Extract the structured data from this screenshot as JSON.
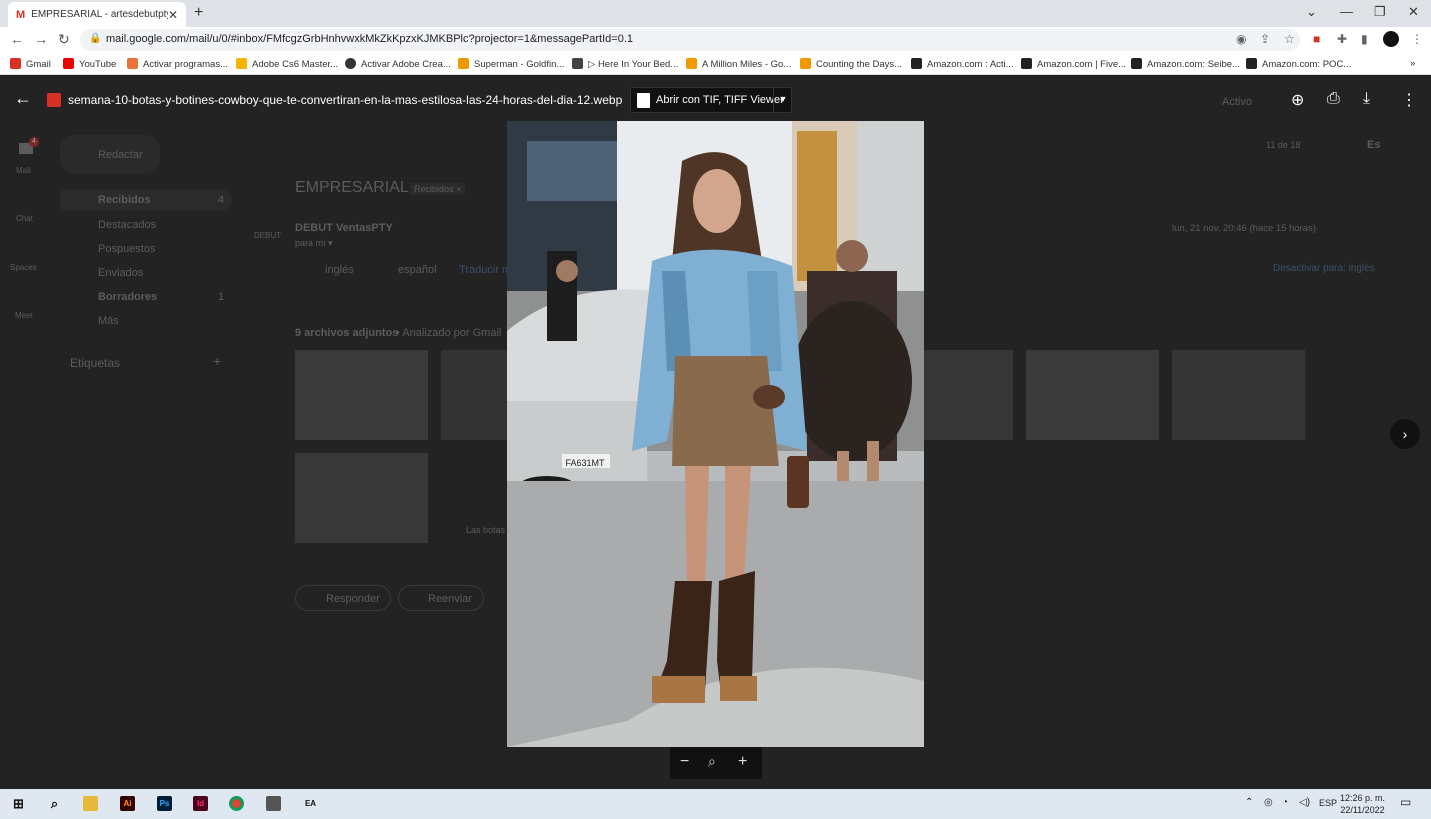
{
  "browser": {
    "tab_title": "EMPRESARIAL - artesdebutpty@",
    "url": "mail.google.com/mail/u/0/#inbox/FMfcgzGrbHnhvwxkMkZkKpzxKJMKBPlc?projector=1&messagePartId=0.1",
    "bookmarks": [
      "Gmail",
      "YouTube",
      "Activar programas...",
      "Adobe Cs6 Master...",
      "Activar Adobe Crea...",
      "Superman - Goldfin...",
      "▷ Here In Your Bed...",
      "A Million Miles - Go...",
      "Counting the Days...",
      "Amazon.com : Acti...",
      "Amazon.com | Five...",
      "Amazon.com: Seibe...",
      "Amazon.com: POC..."
    ]
  },
  "gmail": {
    "compose": "Redactar",
    "rail": [
      "Mail",
      "Chat",
      "Spaces",
      "Meet"
    ],
    "mail_badge": "4",
    "folders": [
      {
        "label": "Recibidos",
        "count": "4"
      },
      {
        "label": "Destacados",
        "count": ""
      },
      {
        "label": "Pospuestos",
        "count": ""
      },
      {
        "label": "Enviados",
        "count": ""
      },
      {
        "label": "Borradores",
        "count": "1"
      },
      {
        "label": "Más",
        "count": ""
      }
    ],
    "labels_heading": "Etiquetas",
    "subject": "EMPRESARIAL",
    "subject_tag": "Recibidos ×",
    "sender": "DEBUT VentasPTY",
    "to_me": "para mí ▾",
    "sender_tag": "DEBUT",
    "date": "lun, 21 nov, 20:46 (hace 15 horas)",
    "translate_from": "inglés",
    "translate_to": "español",
    "translate_link": "Traducir mensaje",
    "translate_off": "Desactivar para: inglés",
    "attachments_label": "9 archivos adjuntos",
    "scanned": "• Analizado por Gmail",
    "attachment_caption": "Las botas",
    "reply": "Responder",
    "forward": "Reenviar",
    "status": "Activo",
    "pager": "11 de 18",
    "lang_btn": "Es"
  },
  "viewer": {
    "filename": "semana-10-botas-y-botines-cowboy-que-te-convertiran-en-la-mas-estilosa-las-24-horas-del-dia-12.webp",
    "open_with": "Abrir con TIF, TIFF Viewer",
    "photo_plate": "FA631MT"
  },
  "taskbar": {
    "apps": [
      "Ai",
      "Ps",
      "Id"
    ],
    "lang": "ESP",
    "time": "12:26 p. m.",
    "date": "22/11/2022"
  },
  "colors": {
    "overlay": "#1f1f1f",
    "gmail_red": "#d93025",
    "shirt_blue": "#7fb0d3",
    "skirt_brown": "#8a6a4d",
    "taskbar": "#dfe7f1"
  }
}
